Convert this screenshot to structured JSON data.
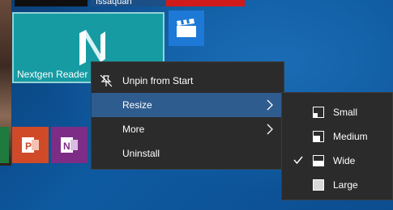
{
  "tiles": {
    "weather_label": "Issaquah",
    "nextgen_label": "Nextgen Reader"
  },
  "context_menu": {
    "items": [
      {
        "label": "Unpin from Start",
        "icon": "unpin-icon"
      },
      {
        "label": "Resize",
        "icon": "none",
        "submenu": true
      },
      {
        "label": "More",
        "icon": "none",
        "submenu": true
      },
      {
        "label": "Uninstall",
        "icon": "none"
      }
    ]
  },
  "resize_submenu": {
    "items": [
      {
        "label": "Small",
        "icon": "size-small-icon"
      },
      {
        "label": "Medium",
        "icon": "size-medium-icon"
      },
      {
        "label": "Wide",
        "icon": "size-wide-icon",
        "checked": true
      },
      {
        "label": "Large",
        "icon": "size-large-icon"
      }
    ]
  },
  "colors": {
    "accent_highlight": "#2f5c8f",
    "menu_bg": "#2b2b2b",
    "nextgen_tile": "#169ba3",
    "video_tile": "#1e78d6",
    "powerpoint_tile": "#d04a27",
    "onenote_tile": "#7d2d86"
  }
}
